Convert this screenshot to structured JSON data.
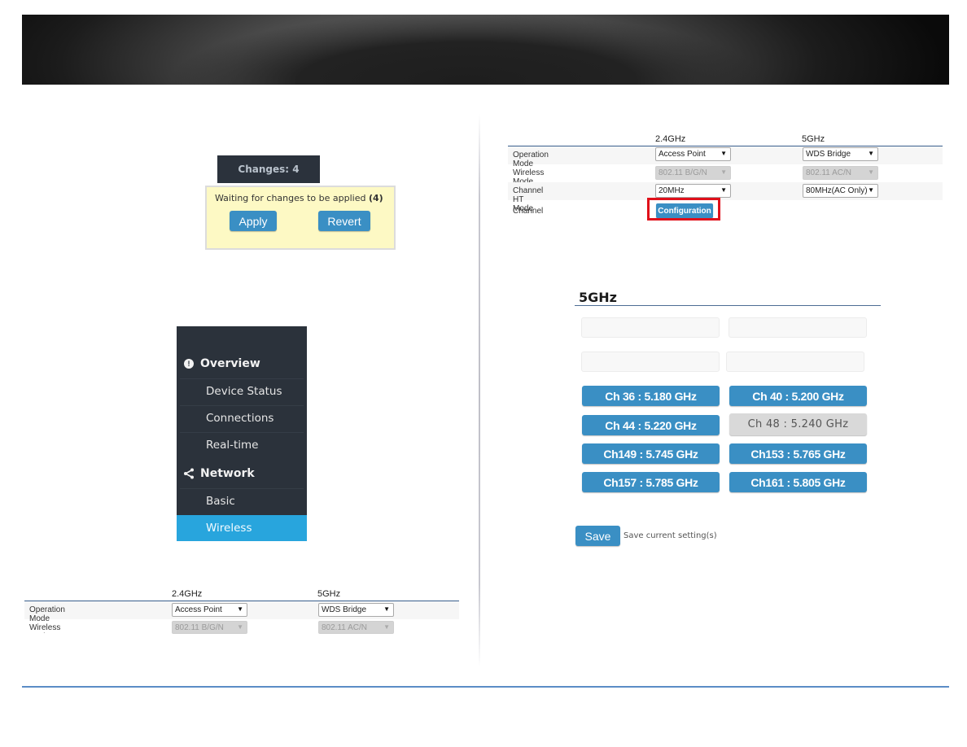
{
  "changes": {
    "badge_label": "Changes: 4",
    "message": "Waiting for changes to be applied",
    "count": "(4)",
    "apply_label": "Apply",
    "revert_label": "Revert"
  },
  "sidebar": {
    "sections": [
      {
        "label": "Overview",
        "icon": "info-icon"
      },
      {
        "label": "Network",
        "icon": "share-icon"
      }
    ],
    "items": [
      {
        "label": "Device Status",
        "active": false
      },
      {
        "label": "Connections",
        "active": false
      },
      {
        "label": "Real-time",
        "active": false
      },
      {
        "label": "Basic",
        "active": false
      },
      {
        "label": "Wireless",
        "active": true
      }
    ]
  },
  "wireless_table_partial": {
    "col_24": "2.4GHz",
    "col_5": "5GHz",
    "rows": [
      {
        "label": "Operation Mode",
        "v24": "Access Point",
        "v5": "WDS Bridge",
        "disabled": false
      },
      {
        "label": "Wireless Mode",
        "v24": "802.11 B/G/N",
        "v5": "802.11 AC/N",
        "disabled": true
      }
    ]
  },
  "wireless_table": {
    "col_24": "2.4GHz",
    "col_5": "5GHz",
    "rows": [
      {
        "label": "Operation Mode",
        "v24": "Access Point",
        "v5": "WDS Bridge",
        "disabled": false
      },
      {
        "label": "Wireless Mode",
        "v24": "802.11 B/G/N",
        "v5": "802.11 AC/N",
        "disabled": true
      },
      {
        "label": "Channel HT Mode",
        "v24": "20MHz",
        "v5": "80MHz(AC Only)",
        "disabled": false
      },
      {
        "label": "Channel"
      }
    ],
    "config_label": "Configuration",
    "highlight_color": "#e0101a"
  },
  "channel_picker": {
    "title": "5GHz",
    "channels": [
      {
        "label": "Ch 36 : 5.180 GHz",
        "current": false
      },
      {
        "label": "Ch 40 : 5.200 GHz",
        "current": false
      },
      {
        "label": "Ch 44 : 5.220 GHz",
        "current": false
      },
      {
        "label": "Ch 48 : 5.240 GHz",
        "current": true
      },
      {
        "label": "Ch149 : 5.745 GHz",
        "current": false
      },
      {
        "label": "Ch153 : 5.765 GHz",
        "current": false
      },
      {
        "label": "Ch157 : 5.785 GHz",
        "current": false
      },
      {
        "label": "Ch161 : 5.805 GHz",
        "current": false
      }
    ],
    "save_label": "Save",
    "save_hint": "Save current setting(s)"
  },
  "colors": {
    "accent_blue": "#3a8fc4",
    "sidebar_bg": "#2b323b",
    "sidebar_active": "#28a5dd",
    "footer_line": "#5b8cc6"
  }
}
